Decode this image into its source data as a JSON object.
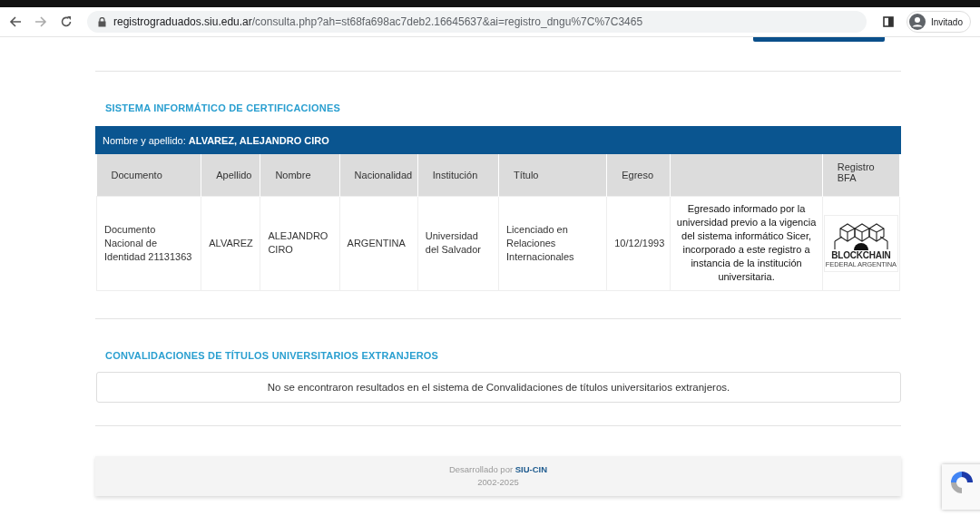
{
  "browser": {
    "url_domain": "registrograduados.siu.edu.ar",
    "url_path": "/consulta.php?ah=st68fa698ac7deb2.16645637&ai=registro_dngu%7C%7C3465",
    "profile_label": "Invitado"
  },
  "certificaciones": {
    "title": "SISTEMA INFORMÁTICO DE CERTIFICACIONES",
    "name_label": "Nombre y apellido:",
    "name_value": "ALVAREZ, ALEJANDRO CIRO",
    "columns": [
      "Documento",
      "Apellido",
      "Nombre",
      "Nacionalidad",
      "Institución",
      "Título",
      "Egreso",
      "",
      "Registro BFA"
    ],
    "rows": [
      {
        "documento": "Documento Nacional de Identidad 21131363",
        "apellido": "ALVAREZ",
        "nombre": "ALEJANDRO CIRO",
        "nacionalidad": "ARGENTINA",
        "institucion": "Universidad del Salvador",
        "titulo": "Licenciado en Relaciones Internacionales",
        "egreso": "10/12/1993",
        "nota": "Egresado informado por la universidad previo a la vigencia del sistema informático Sicer, incorporado a este registro a instancia de la institución universitaria.",
        "bfa_logo": "BLOCKCHAIN",
        "bfa_subtitle": "FEDERAL ARGENTINA"
      }
    ]
  },
  "convalidaciones": {
    "title": "CONVALIDACIONES DE TÍTULOS UNIVERSITARIOS EXTRANJEROS",
    "message": "No se encontraron resultados en el sistema de Convalidaciones de títulos universitarios extranjeros."
  },
  "footer": {
    "developed_by": "Desarrollado por",
    "developer": "SIU-CIN",
    "years": "2002-2025"
  }
}
